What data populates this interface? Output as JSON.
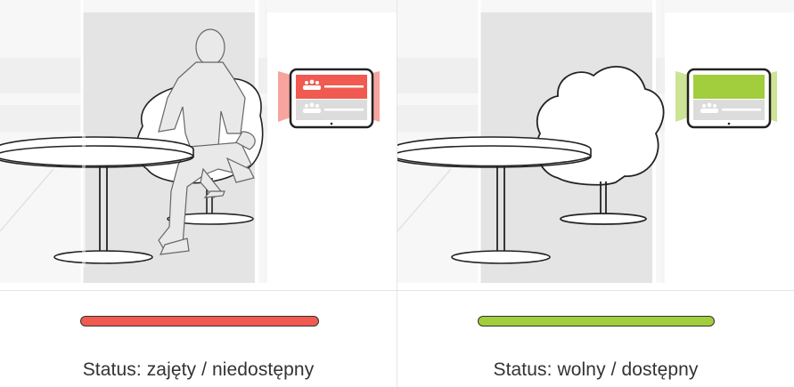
{
  "panels": [
    {
      "id": "occupied",
      "status_label": "Status: zajęty / niedostępny",
      "status_color": "#f05a50",
      "device_state": "occupied"
    },
    {
      "id": "available",
      "status_label": "Status: wolny / dostępny",
      "status_color": "#a2cd3c",
      "device_state": "available"
    }
  ],
  "colors": {
    "busy_red": "#f05a50",
    "free_green": "#a2cd3c",
    "booth_gray": "#e6e6e6"
  }
}
